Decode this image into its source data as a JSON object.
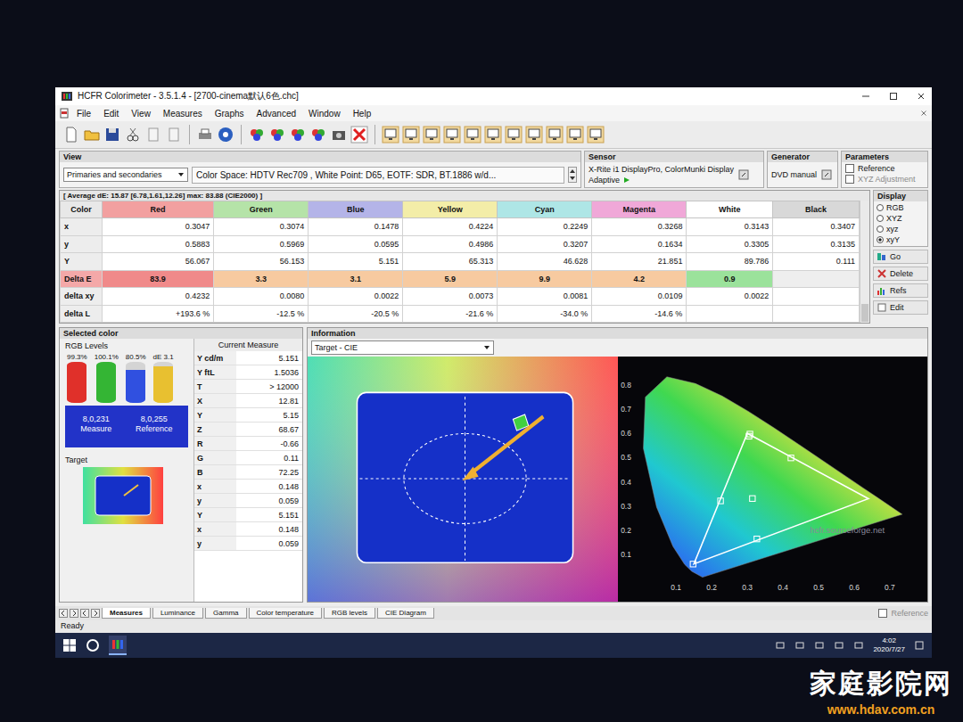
{
  "window": {
    "title": "HCFR Colorimeter - 3.5.1.4 - [2700-cinema默认6色.chc]"
  },
  "menu": [
    "File",
    "Edit",
    "View",
    "Measures",
    "Graphs",
    "Advanced",
    "Window",
    "Help"
  ],
  "view": {
    "label": "View",
    "dropdown": "Primaries and secondaries",
    "info": "Color Space: HDTV Rec709 , White Point: D65, EOTF:  SDR, BT.1886 w/d..."
  },
  "sensor": {
    "label": "Sensor",
    "name": "X-Rite i1 DisplayPro, ColorMunki Display",
    "mode": "Adaptive"
  },
  "generator": {
    "label": "Generator",
    "name": "DVD manual"
  },
  "parameters": {
    "label": "Parameters",
    "options": [
      {
        "label": "Reference",
        "checked": false,
        "disabled": false
      },
      {
        "label": "XYZ Adjustment",
        "checked": false,
        "disabled": true
      }
    ]
  },
  "table": {
    "summary": "[ Average dE: 15.87 [6.78,1.61,12.26] max: 83.88 (CIE2000) ]",
    "corner": "Color",
    "columns": [
      {
        "label": "Red",
        "color": "#f2a0a0"
      },
      {
        "label": "Green",
        "color": "#b5e3a8"
      },
      {
        "label": "Blue",
        "color": "#b4b4e8"
      },
      {
        "label": "Yellow",
        "color": "#f3eda8"
      },
      {
        "label": "Cyan",
        "color": "#aee6e6"
      },
      {
        "label": "Magenta",
        "color": "#f0a8d8"
      },
      {
        "label": "White",
        "color": "#ffffff"
      },
      {
        "label": "Black",
        "color": "#d8d8d8"
      }
    ],
    "rows": [
      {
        "label": "x",
        "kind": "value",
        "cells": [
          "0.3047",
          "0.3074",
          "0.1478",
          "0.4224",
          "0.2249",
          "0.3268",
          "0.3143",
          "0.3407"
        ]
      },
      {
        "label": "y",
        "kind": "value",
        "cells": [
          "0.5883",
          "0.5969",
          "0.0595",
          "0.4986",
          "0.3207",
          "0.1634",
          "0.3305",
          "0.3135"
        ]
      },
      {
        "label": "Y",
        "kind": "value",
        "cells": [
          "56.067",
          "56.153",
          "5.151",
          "65.313",
          "46.628",
          "21.851",
          "89.786",
          "0.111"
        ]
      },
      {
        "label": "Delta E",
        "kind": "delta",
        "cells": [
          "83.9",
          "3.3",
          "3.1",
          "5.9",
          "9.9",
          "4.2",
          "0.9",
          ""
        ],
        "colors": [
          "#f08a8a",
          "#f7caa0",
          "#f7caa0",
          "#f7caa0",
          "#f7caa0",
          "#f7caa0",
          "#9be29b",
          "#eeeeee"
        ]
      },
      {
        "label": "delta xy",
        "kind": "value",
        "cells": [
          "0.4232",
          "0.0080",
          "0.0022",
          "0.0073",
          "0.0081",
          "0.0109",
          "0.0022",
          ""
        ]
      },
      {
        "label": "delta L",
        "kind": "value",
        "cells": [
          "+193.6 %",
          "-12.5 %",
          "-20.5 %",
          "-21.6 %",
          "-34.0 %",
          "-14.6 %",
          "",
          ""
        ]
      }
    ]
  },
  "display": {
    "label": "Display",
    "options": [
      {
        "label": "RGB",
        "selected": false
      },
      {
        "label": "XYZ",
        "selected": false
      },
      {
        "label": "xyz",
        "selected": false
      },
      {
        "label": "xyY",
        "selected": true
      }
    ],
    "buttons": [
      "Go",
      "Delete",
      "Refs",
      "Edit"
    ]
  },
  "selected_color": {
    "label": "Selected color",
    "levels_label": "RGB Levels",
    "bars": [
      {
        "reading": "99.3%",
        "level": 0.993,
        "color": "#e0302a"
      },
      {
        "reading": "100.1%",
        "level": 1.001,
        "color": "#34b534"
      },
      {
        "reading": "80.5%",
        "level": 0.805,
        "color": "#3050e0"
      },
      {
        "reading": "dE 3.1",
        "level": 0.9,
        "color": "#e8c030"
      }
    ],
    "measure": {
      "value": "8,0,231",
      "label": "Measure"
    },
    "reference": {
      "value": "8,0,255",
      "label": "Reference"
    },
    "target_label": "Target"
  },
  "current_measure": {
    "label": "Current Measure",
    "rows": [
      {
        "label": "Y cd/m",
        "value": "5.151"
      },
      {
        "label": "Y ftL",
        "value": "1.5036"
      },
      {
        "label": "T",
        "value": "> 12000"
      },
      {
        "label": "X",
        "value": "12.81"
      },
      {
        "label": "Y",
        "value": "5.15"
      },
      {
        "label": "Z",
        "value": "68.67"
      },
      {
        "label": "R",
        "value": "-0.66"
      },
      {
        "label": "G",
        "value": "0.11"
      },
      {
        "label": "B",
        "value": "72.25"
      },
      {
        "label": "x",
        "value": "0.148"
      },
      {
        "label": "y",
        "value": "0.059"
      },
      {
        "label": "Y",
        "value": "5.151"
      },
      {
        "label": "x",
        "value": "0.148"
      },
      {
        "label": "y",
        "value": "0.059"
      }
    ]
  },
  "information": {
    "label": "Information",
    "dropdown": "Target - CIE"
  },
  "cie_chart": {
    "x_ticks": [
      "0.1",
      "0.2",
      "0.3",
      "0.4",
      "0.5",
      "0.6",
      "0.7"
    ],
    "y_ticks": [
      "0.1",
      "0.2",
      "0.3",
      "0.4",
      "0.5",
      "0.6",
      "0.7",
      "0.8"
    ],
    "watermark": "hcfr.sourceforge.net",
    "locus": {
      "x": [
        0.1741,
        0.144,
        0.1241,
        0.0913,
        0.0454,
        0.0082,
        0.0139,
        0.0743,
        0.1547,
        0.2296,
        0.3016,
        0.3731,
        0.4441,
        0.5125,
        0.5752,
        0.627,
        0.6658,
        0.7347
      ],
      "y": [
        0.005,
        0.0297,
        0.0578,
        0.1327,
        0.295,
        0.5384,
        0.7502,
        0.8338,
        0.8059,
        0.7543,
        0.6923,
        0.6245,
        0.5547,
        0.4866,
        0.4242,
        0.3725,
        0.334,
        0.2653
      ]
    },
    "reference": {
      "x": [
        0.64,
        0.3,
        0.15
      ],
      "y": [
        0.33,
        0.6,
        0.06
      ]
    },
    "measured": {
      "x": [
        0.3047,
        0.3074,
        0.1478,
        0.4224,
        0.2249,
        0.3268,
        0.3143
      ],
      "y": [
        0.5883,
        0.5969,
        0.0595,
        0.4986,
        0.3207,
        0.1634,
        0.3305
      ]
    }
  },
  "bottom_tabs": [
    {
      "label": "Measures",
      "selected": true
    },
    {
      "label": "Luminance",
      "selected": false
    },
    {
      "label": "Gamma",
      "selected": false
    },
    {
      "label": "Color temperature",
      "selected": false
    },
    {
      "label": "RGB levels",
      "selected": false
    },
    {
      "label": "CIE Diagram",
      "selected": false
    }
  ],
  "bottom_reference": {
    "label": "Reference",
    "checked": false
  },
  "status_bar": "Ready",
  "taskbar": {
    "time": "4:02",
    "date": "2020/7/27"
  },
  "watermark": {
    "title": "家庭影院网",
    "url": "www.hdav.com.cn"
  }
}
